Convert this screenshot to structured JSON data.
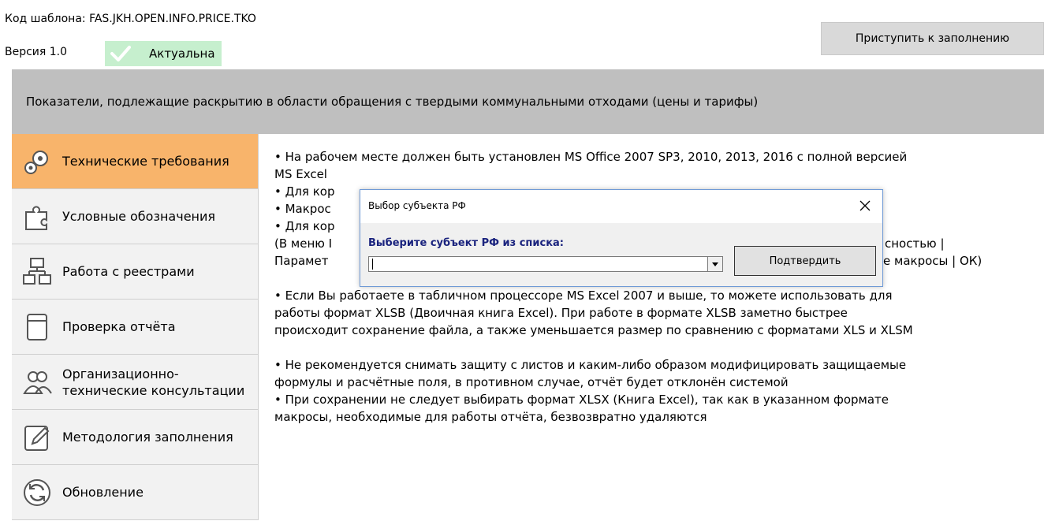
{
  "header": {
    "template_code": "Код шаблона: FAS.JKH.OPEN.INFO.PRICE.TKO",
    "version": "Версия 1.0",
    "status": "Актуальна",
    "start_button": "Приступить к заполнению"
  },
  "banner": {
    "title": "Показатели, подлежащие раскрытию в области обращения с твердыми коммунальными отходами (цены и тарифы)"
  },
  "sidebar": {
    "items": [
      {
        "label": "Технические требования",
        "icon": "gears-icon",
        "active": true
      },
      {
        "label": "Условные обозначения",
        "icon": "puzzle-icon",
        "active": false
      },
      {
        "label": "Работа с реестрами",
        "icon": "registry-icon",
        "active": false
      },
      {
        "label": "Проверка отчёта",
        "icon": "report-check-icon",
        "active": false
      },
      {
        "label": "Организационно-\nтехнические консультации",
        "icon": "people-icon",
        "active": false
      },
      {
        "label": "Методология заполнения",
        "icon": "edit-icon",
        "active": false
      },
      {
        "label": "Обновление",
        "icon": "refresh-icon",
        "active": false
      }
    ]
  },
  "content": {
    "p1a": "• На рабочем месте должен быть установлен MS Office 2007 SP3, 2010, 2013, 2016 с полной версией",
    "p1b": "MS Excel",
    "p2": "• Для кор",
    "p3": "• Макрос",
    "p4": "• Для кор",
    "p5a": "(В меню I",
    "p5b": "сностью |",
    "p6a": "Парамет",
    "p6b": "е макросы | ОК)",
    "p7": "• Если Вы работаете в табличном процессоре MS Excel 2007 и выше, то можете использовать для",
    "p8": "работы формат XLSB (Двоичная книга Excel). При работе в формате XLSB заметно быстрее",
    "p9": "происходит сохранение файла, а также уменьшается размер по сравнению с форматами XLS и XLSM",
    "p10": "• Не рекомендуется снимать защиту с листов и каким-либо образом модифицировать защищаемые",
    "p11": "формулы и расчётные поля, в противном случае, отчёт будет отклонён системой",
    "p12": "• При сохранении не следует выбирать формат XLSX (Книга Excel), так как в указанном формате",
    "p13": "макросы, необходимые для работы отчёта, безвозвратно удаляются"
  },
  "dialog": {
    "title": "Выбор субъекта РФ",
    "prompt": "Выберите субъект РФ из списка:",
    "select_value": "",
    "confirm_button": "Подтвердить"
  },
  "colors": {
    "active_item": "#f8b46b",
    "status_bg": "#c6efce",
    "banner_bg": "#bfbfbf"
  }
}
